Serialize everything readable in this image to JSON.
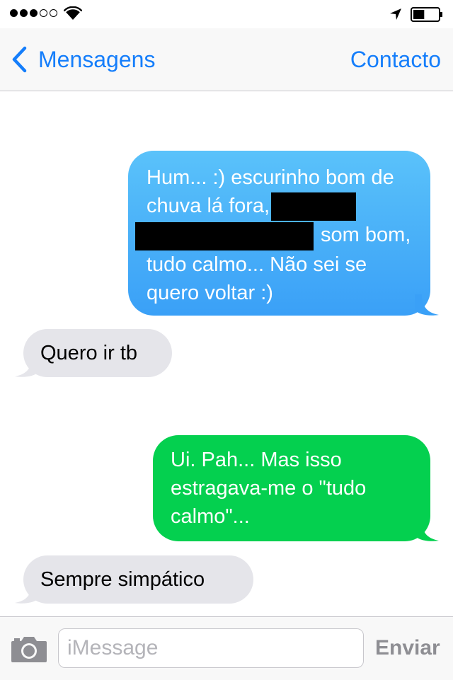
{
  "status_bar": {
    "signal_strength": 3,
    "signal_max": 5,
    "wifi_icon": "wifi-icon",
    "location_icon": "location-arrow-icon",
    "battery_icon": "battery-icon",
    "battery_level": 0.45
  },
  "nav": {
    "back_label": "Mensagens",
    "back_icon": "chevron-left-icon",
    "contact_label": "Contacto",
    "accent_color": "#157efb"
  },
  "messages": [
    {
      "direction": "sent",
      "kind": "imessage",
      "text_before_redaction": "Hum... :) escurinho bom de chuva lá fora,",
      "text_after_redaction": "som bom, tudo calmo... Não sei se quero voltar :)",
      "has_redactions": true,
      "color": "#3aa0f7"
    },
    {
      "direction": "received",
      "text": "Quero ir tb",
      "color": "#e5e5ea"
    },
    {
      "direction": "sent",
      "kind": "sms",
      "text": "Ui. Pah... Mas isso estragava-me o \"tudo calmo\"...",
      "color": "#04d04f"
    },
    {
      "direction": "received",
      "text": "Sempre simpático",
      "color": "#e5e5ea"
    }
  ],
  "input_bar": {
    "camera_icon": "camera-icon",
    "placeholder": "iMessage",
    "value": "",
    "send_label": "Enviar"
  }
}
